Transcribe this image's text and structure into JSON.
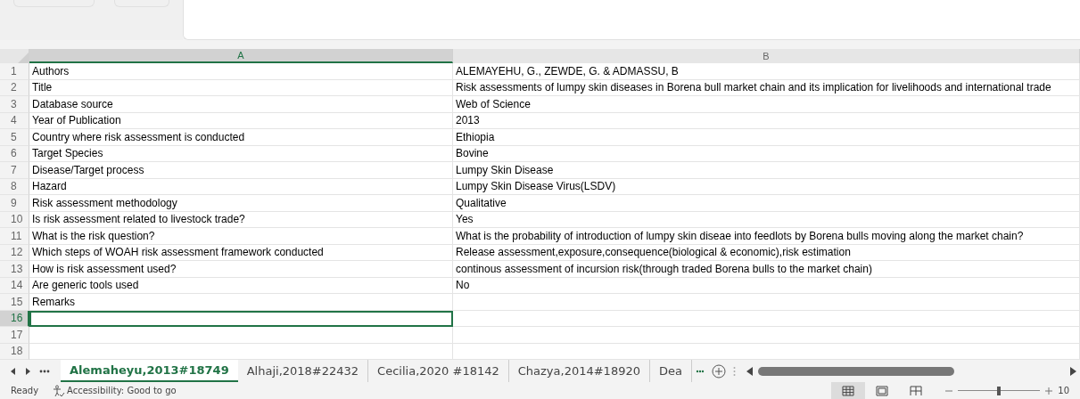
{
  "columns": [
    {
      "label": "A",
      "selected": true
    },
    {
      "label": "B",
      "selected": false
    }
  ],
  "rows": [
    {
      "number": "1",
      "selected": false,
      "cells": [
        "Authors",
        "ALEMAYEHU, G., ZEWDE, G. & ADMASSU, B"
      ]
    },
    {
      "number": "2",
      "selected": false,
      "cells": [
        "Title",
        "Risk assessments of lumpy skin diseases in Borena bull market chain and its implication for livelihoods and international trade"
      ]
    },
    {
      "number": "3",
      "selected": false,
      "cells": [
        "Database source",
        "Web of Science"
      ]
    },
    {
      "number": "4",
      "selected": false,
      "cells": [
        "Year of Publication",
        "2013"
      ]
    },
    {
      "number": "5",
      "selected": false,
      "cells": [
        "Country where risk assessment is  conducted",
        "Ethiopia"
      ]
    },
    {
      "number": "6",
      "selected": false,
      "cells": [
        "Target Species",
        "Bovine"
      ]
    },
    {
      "number": "7",
      "selected": false,
      "cells": [
        "Disease/Target process",
        "Lumpy Skin Disease"
      ]
    },
    {
      "number": "8",
      "selected": false,
      "cells": [
        "Hazard",
        "Lumpy Skin Disease Virus(LSDV)"
      ]
    },
    {
      "number": "9",
      "selected": false,
      "cells": [
        "Risk assessment methodology",
        "Qualitative"
      ]
    },
    {
      "number": "10",
      "selected": false,
      "cells": [
        "Is risk assessment  related to livestock trade?",
        "Yes"
      ]
    },
    {
      "number": "11",
      "selected": false,
      "cells": [
        "What is the risk question?",
        "What is the probability of introduction of lumpy skin diseae into feedlots by Borena bulls moving along the market chain?"
      ]
    },
    {
      "number": "12",
      "selected": false,
      "cells": [
        "Which steps of WOAH risk  assessment  framework conducted",
        "Release assessment,exposure,consequence(biological & economic),risk estimation"
      ]
    },
    {
      "number": "13",
      "selected": false,
      "cells": [
        "How is risk assessment used?",
        "continous assessment of incursion risk(through traded Borena bulls to the market chain)"
      ]
    },
    {
      "number": "14",
      "selected": false,
      "cells": [
        "Are generic tools  used",
        "No"
      ]
    },
    {
      "number": "15",
      "selected": false,
      "cells": [
        "Remarks"
      ]
    },
    {
      "number": "16",
      "selected": true
    },
    {
      "number": "17",
      "selected": false
    },
    {
      "number": "18",
      "selected": false
    }
  ],
  "sheet_tabs": [
    {
      "label": "Alemaheyu,2013#18749",
      "selected": true
    },
    {
      "label": "Alhaji,2018#22432",
      "selected": false
    },
    {
      "label": "Cecilia,2020 #18142",
      "selected": false
    },
    {
      "label": "Chazya,2014#18920",
      "selected": false
    },
    {
      "label": "Dea",
      "selected": false
    }
  ],
  "status_bar": {
    "status": "Ready",
    "accessibility": "Accessibility: Good to go",
    "views": [
      {
        "kind": "normal",
        "selected": true
      },
      {
        "kind": "page_layout",
        "selected": false
      },
      {
        "kind": "page_break",
        "selected": false
      }
    ],
    "zoom": {
      "level": 0.5,
      "reading": "10"
    }
  }
}
